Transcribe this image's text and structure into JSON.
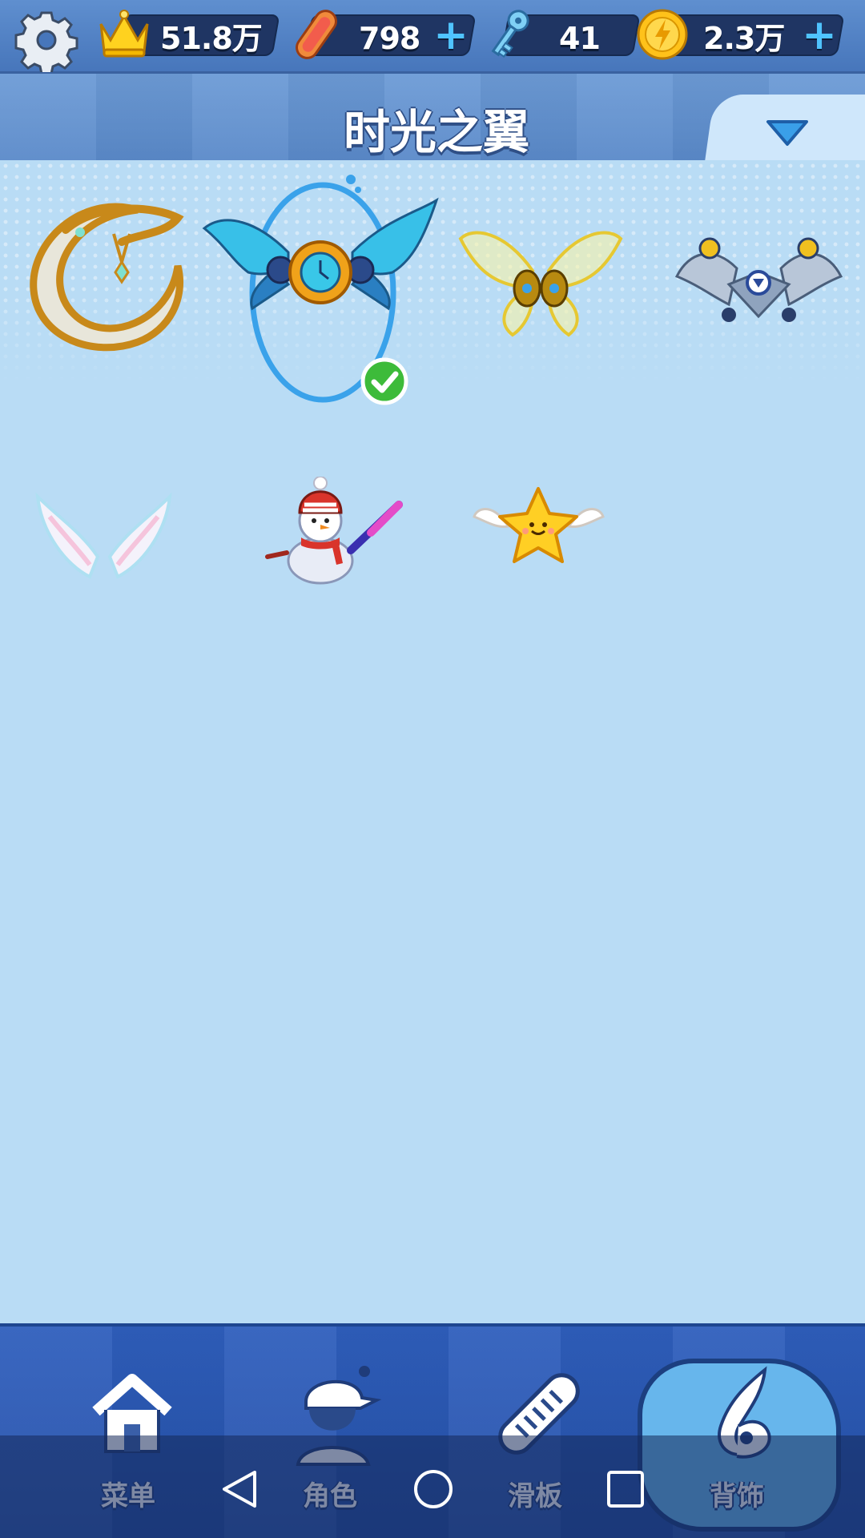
{
  "header": {
    "settings_icon": "gear-icon",
    "currencies": [
      {
        "name": "crown",
        "icon": "crown-icon",
        "value": "51.8万",
        "has_plus": false
      },
      {
        "name": "skateboard",
        "icon": "skateboard-icon",
        "value": "798",
        "has_plus": true
      },
      {
        "name": "key",
        "icon": "key-icon",
        "value": "41",
        "has_plus": false
      },
      {
        "name": "coin",
        "icon": "coin-icon",
        "value": "2.3万",
        "has_plus": true
      }
    ],
    "plus_glyph": "+"
  },
  "page": {
    "title": "时光之翼",
    "dropdown_icon": "triangle-down-icon"
  },
  "items": [
    {
      "icon": "crescent-moon-backpiece-icon",
      "selected": false
    },
    {
      "icon": "clockwork-wings-backpiece-icon",
      "selected": true
    },
    {
      "icon": "golden-butterfly-wings-icon",
      "selected": false
    },
    {
      "icon": "mechanical-wings-icon",
      "selected": false
    },
    {
      "icon": "angel-wings-icon",
      "selected": false
    },
    {
      "icon": "snowman-icon",
      "selected": false
    },
    {
      "icon": "winged-star-icon",
      "selected": false
    }
  ],
  "nav": {
    "tabs": [
      {
        "label": "菜单",
        "icon": "home-icon",
        "active": false
      },
      {
        "label": "角色",
        "icon": "character-icon",
        "active": false
      },
      {
        "label": "滑板",
        "icon": "skateboard-icon",
        "active": false
      },
      {
        "label": "背饰",
        "icon": "wing-icon",
        "active": true
      }
    ]
  },
  "system_nav": [
    "back-icon",
    "home-circle-icon",
    "recents-icon"
  ],
  "colors": {
    "panel_bg": "#b9dcf5",
    "header_bg": "#4776bb",
    "nav_bg": "#2550a8",
    "active_tab": "#67b6ec",
    "selection_ring": "#3aa2ea",
    "check_green": "#3dbb3a",
    "plus_blue": "#4fc3ff"
  }
}
